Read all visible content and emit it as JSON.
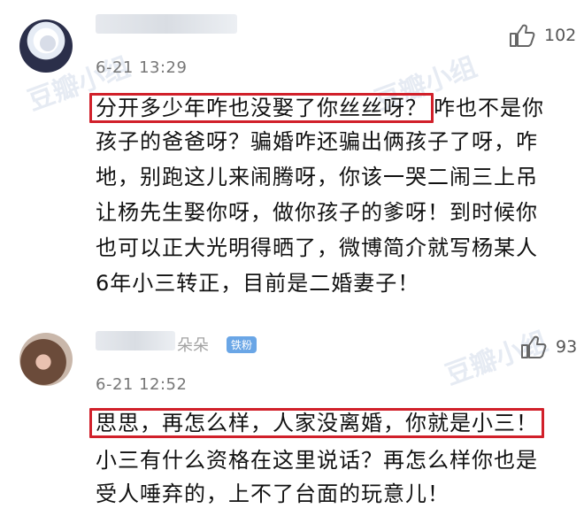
{
  "comments": [
    {
      "username": "",
      "badge": "",
      "time": "6-21 13:29",
      "like_count": "102",
      "lines": [
        {
          "highlight": "分开多少年咋也没娶了你丝丝呀？",
          "rest": "咋也不是你"
        },
        {
          "text": "孩子的爸爸呀？骗婚咋还骗出俩孩子了呀，咋"
        },
        {
          "text": "地，别跑这儿来闹腾呀，你该一哭二闹三上吊"
        },
        {
          "text": "让杨先生娶你呀，做你孩子的爹呀！到时候你"
        },
        {
          "text": "也可以正大光明得晒了，微博简介就写杨某人"
        },
        {
          "text": "6年小三转正，目前是二婚妻子！"
        }
      ]
    },
    {
      "username": "朵朵",
      "badge": "铁粉",
      "time": "6-21 12:52",
      "like_count": "93",
      "lines": [
        {
          "highlight": "思思，再怎么样，人家没离婚，你就是小三！",
          "rest": ""
        },
        {
          "text": "小三有什么资格在这里说话？再怎么样你也是"
        },
        {
          "text": "受人唾弃的，上不了台面的玩意儿！"
        }
      ]
    }
  ],
  "watermark_text": "豆瓣小组",
  "icons": {
    "like": "thumbs-up-icon"
  }
}
